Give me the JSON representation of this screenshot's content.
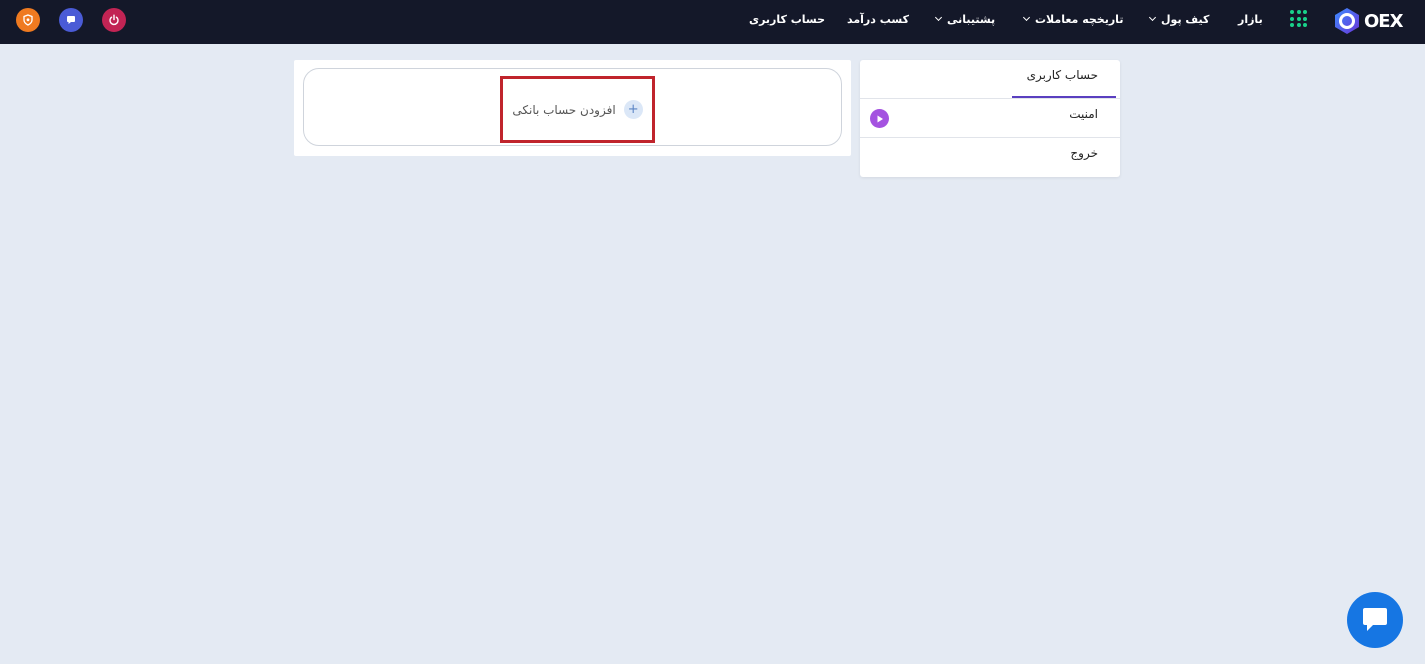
{
  "brand": {
    "logo_text": "OEX"
  },
  "nav": {
    "market": "بازار",
    "wallet": "کیف پول",
    "trade_history": "تاریخچه معاملات",
    "support": "پشتیبانی",
    "earn": "کسب درآمد",
    "account": "حساب کاربری"
  },
  "icons": {
    "apps": "grid-icon",
    "power": "power-icon",
    "chat": "chat-icon",
    "badge": "shield-icon"
  },
  "colors": {
    "topbar": "#141829",
    "accent": "#5a3fc0",
    "highlight_border": "#c0242c",
    "chat_fab": "#1676e3",
    "power": "#c22454",
    "chat_small": "#4a5bd6",
    "badge": "#ef7a20"
  },
  "sidebar": {
    "header": "حساب کاربری",
    "items": [
      {
        "label": "امنیت"
      },
      {
        "label": "خروج"
      }
    ]
  },
  "main": {
    "add_bank_label": "افزودن حساب بانکی",
    "add_symbol": "+"
  }
}
